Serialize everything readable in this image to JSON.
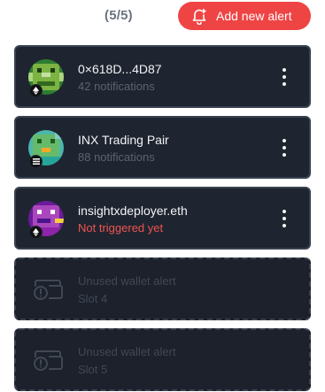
{
  "header": {
    "slot_count": "(5/5)",
    "add_button_label": "Add new alert"
  },
  "alerts": [
    {
      "title": "0×618D...4D87",
      "subtitle": "42 notifications",
      "status": "normal"
    },
    {
      "title": "INX Trading Pair",
      "subtitle": "88 notifications",
      "status": "normal"
    },
    {
      "title": "insightxdeployer.eth",
      "subtitle": "Not triggered yet",
      "status": "warning"
    },
    {
      "title": "Unused wallet alert",
      "subtitle": "Slot 4",
      "status": "unused"
    },
    {
      "title": "Unused wallet alert",
      "subtitle": "Slot 5",
      "status": "unused"
    }
  ],
  "icons": {
    "add_alert": "bell-plus-icon",
    "more": "more-vertical-icon",
    "unused": "wallet-alert-icon"
  },
  "colors": {
    "accent": "#ef4444",
    "card_bg": "#1f2530",
    "card_border": "#3a4150",
    "warning_text": "#ef5350",
    "muted_text": "#5b6271"
  }
}
